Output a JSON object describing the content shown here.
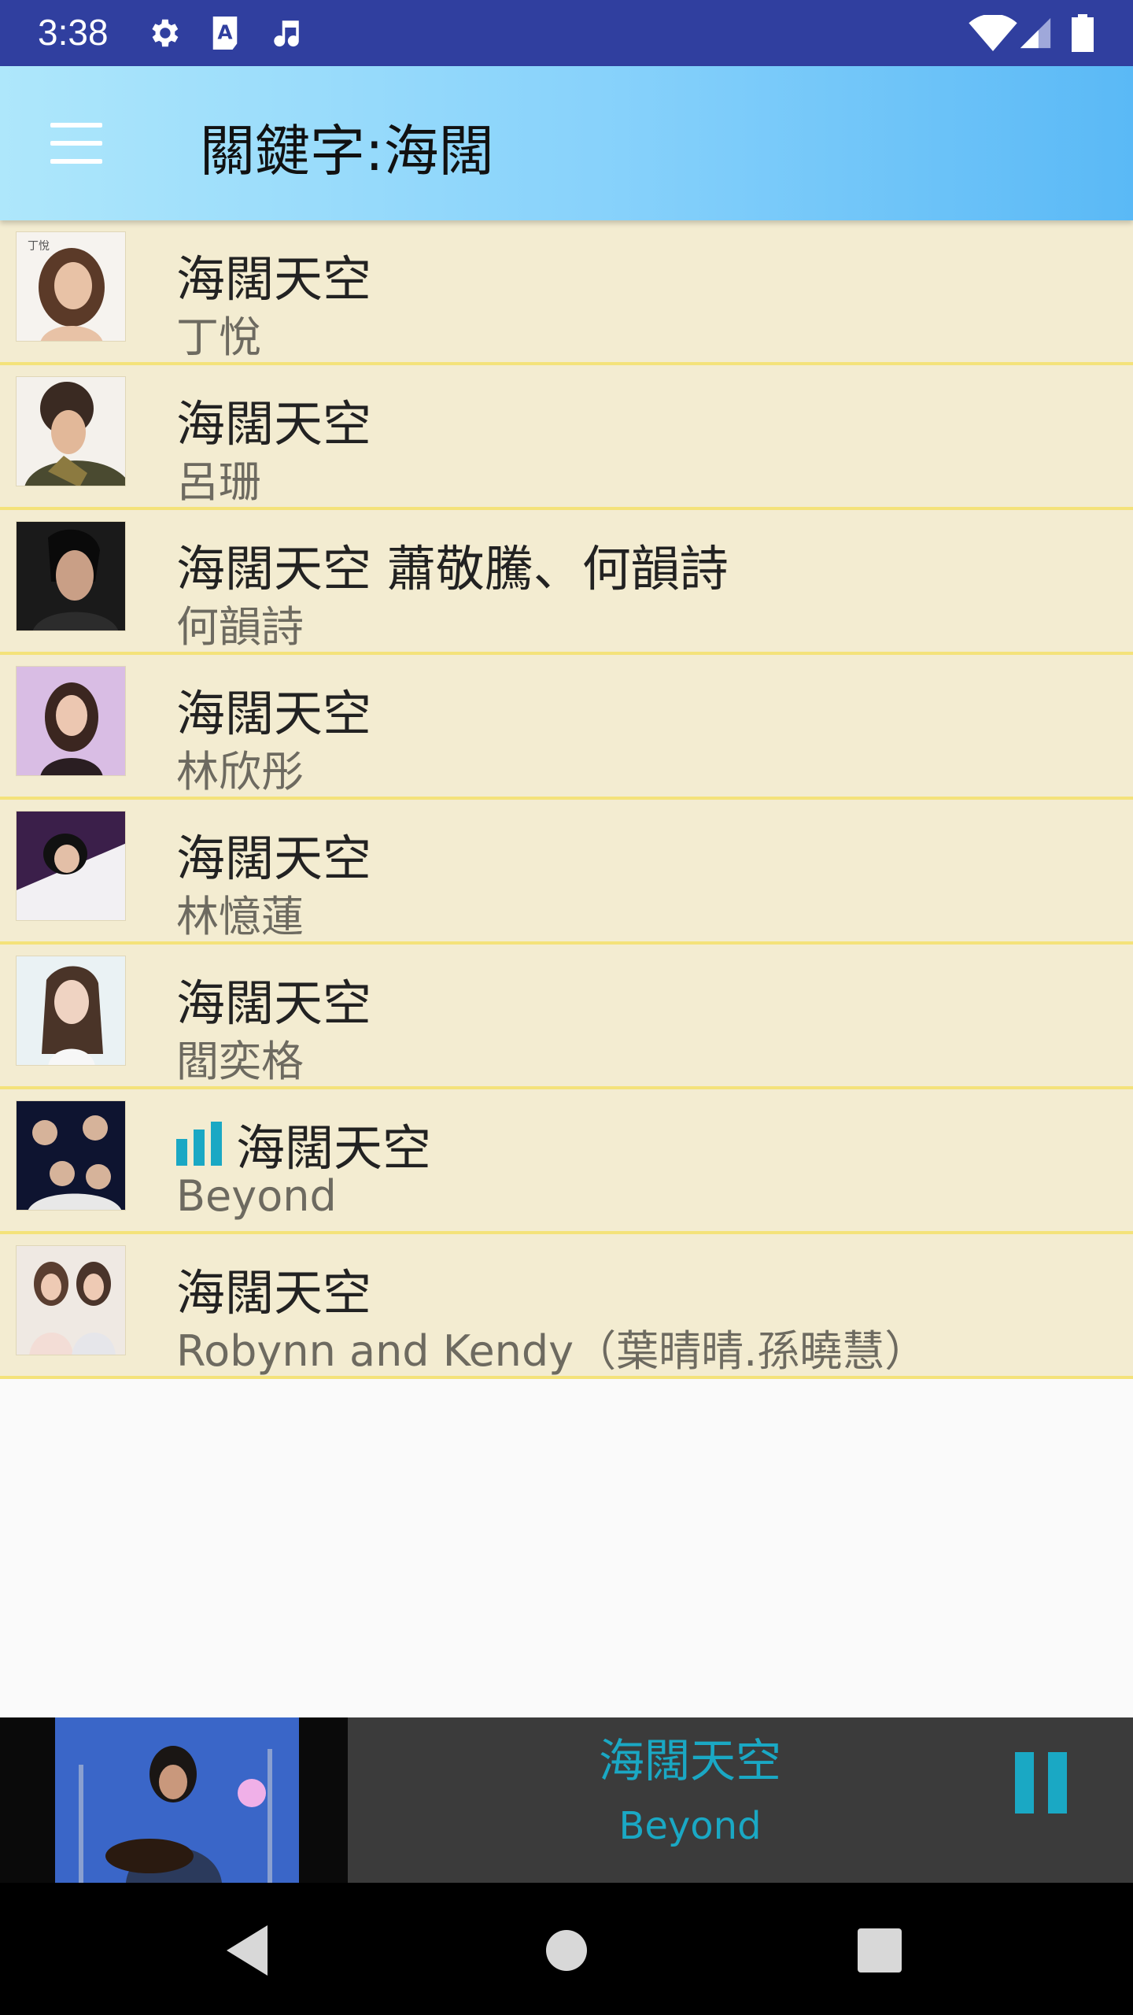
{
  "status_bar": {
    "time": "3:38",
    "left_icons": [
      "settings-icon",
      "a-icon",
      "music-note-icon"
    ],
    "right_icons": [
      "wifi-icon",
      "signal-icon",
      "battery-icon"
    ],
    "background": "#303f9f"
  },
  "app_bar": {
    "title": "關鍵字:海闊",
    "menu_icon": "menu-icon"
  },
  "songs": [
    {
      "title": "海闊天空",
      "artist": "丁悅",
      "playing": false
    },
    {
      "title": "海闊天空",
      "artist": "呂珊",
      "playing": false
    },
    {
      "title": "海闊天空 蕭敬騰、何韻詩",
      "artist": "何韻詩",
      "playing": false
    },
    {
      "title": "海闊天空",
      "artist": "林欣彤",
      "playing": false
    },
    {
      "title": "海闊天空",
      "artist": "林憶蓮",
      "playing": false
    },
    {
      "title": "海闊天空",
      "artist": "閻奕格",
      "playing": false
    },
    {
      "title": "海闊天空",
      "artist": "Beyond",
      "playing": true
    },
    {
      "title": "海闊天空",
      "artist": "Robynn and Kendy（葉晴晴.孫曉慧）",
      "playing": false
    }
  ],
  "player": {
    "title": "海闊天空",
    "artist": "Beyond",
    "accent": "#1aa8c4"
  },
  "nav_bar": {
    "buttons": [
      "back-icon",
      "home-icon",
      "recents-icon"
    ]
  },
  "colors": {
    "list_bg": "#f3ecd1",
    "divider": "#f4e27a",
    "accent": "#1aa8c4"
  }
}
